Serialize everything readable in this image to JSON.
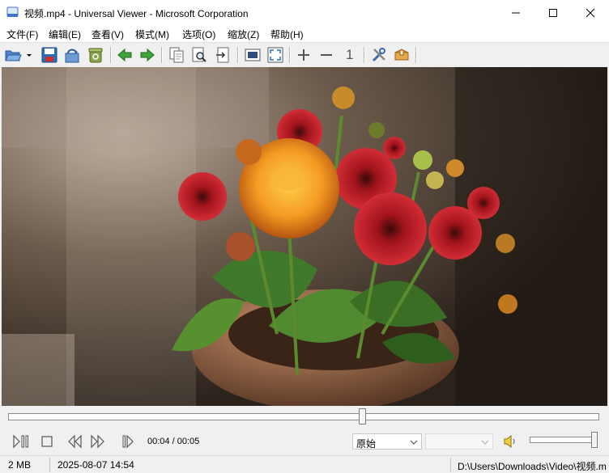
{
  "window": {
    "title": "视频.mp4 - Universal Viewer - Microsoft Corporation",
    "controls": [
      "minimize-icon",
      "maximize-icon",
      "close-icon"
    ]
  },
  "menu": {
    "items": [
      {
        "label": "文件(F)"
      },
      {
        "label": "编辑(E)"
      },
      {
        "label": "查看(V)"
      },
      {
        "label": "模式(M)"
      },
      {
        "label": "选项(O)"
      },
      {
        "label": "缩放(Z)"
      },
      {
        "label": "帮助(H)"
      }
    ]
  },
  "toolbar": {
    "icons": [
      "open-folder-icon",
      "dropdown-arrow-icon",
      "save-icon",
      "reload-icon",
      "recycle-bin-icon",
      "previous-file-icon",
      "next-file-icon",
      "copy-icon",
      "find-icon",
      "export-icon",
      "show-image-icon",
      "fullscreen-icon",
      "zoom-in-icon",
      "zoom-out-icon",
      "original-size-icon",
      "settings-icon",
      "package-icon"
    ],
    "original_size_label": "1"
  },
  "player": {
    "position_fraction": 0.6,
    "time": "00:04 / 00:05",
    "zoom_mode": "原始",
    "audio_track": "",
    "volume_fraction": 1.0,
    "control_icons": [
      "play-pause-icon",
      "stop-icon",
      "rewind-icon",
      "fast-forward-icon",
      "next-frame-icon",
      "volume-icon"
    ]
  },
  "status": {
    "size": "2 MB",
    "modified": "2025-08-07 14:54",
    "path": "D:\\Users\\Downloads\\Video\\视频.mp4"
  },
  "colors": {
    "accent_green": "#3da23a",
    "toolbar_blue": "#2d6db5",
    "window_bg": "#f0f0f0"
  }
}
